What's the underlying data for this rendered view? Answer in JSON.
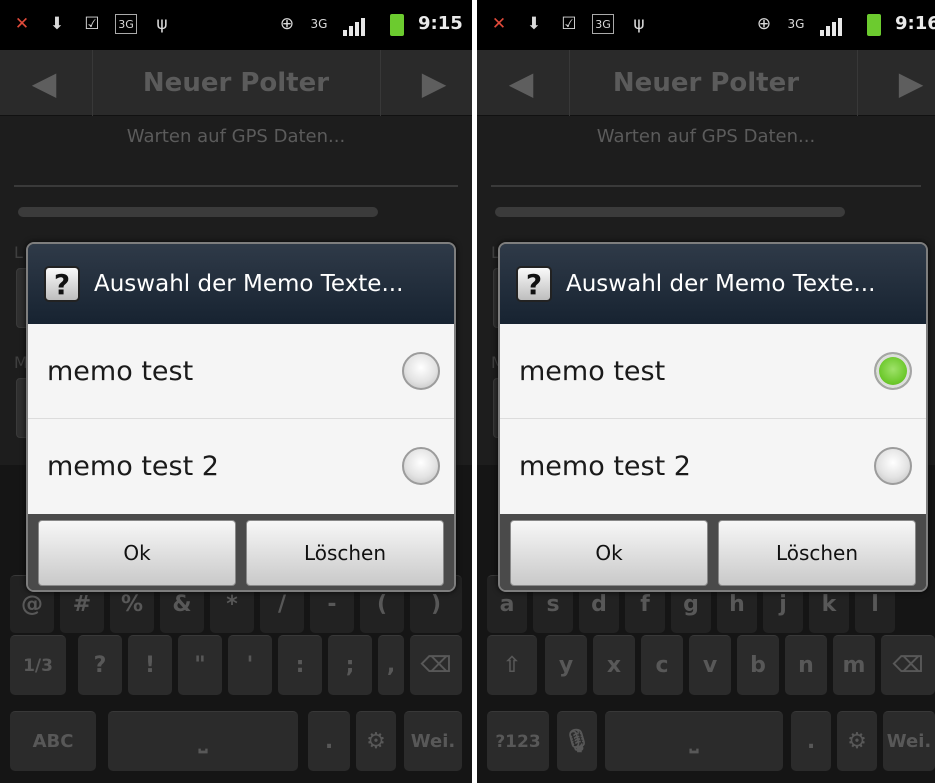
{
  "screens": [
    {
      "status": {
        "time": "9:15"
      },
      "title": "Neuer Polter",
      "gps_status": "Warten auf GPS Daten...",
      "dialog": {
        "title": "Auswahl der Memo Texte...",
        "items": [
          {
            "label": "memo test",
            "checked": false
          },
          {
            "label": "memo test 2",
            "checked": false
          }
        ],
        "ok_label": "Ok",
        "delete_label": "Löschen"
      },
      "keyboard": {
        "row2": [
          "1/3",
          "?",
          "!",
          "\"",
          "'",
          ":",
          ";",
          ","
        ],
        "row3": {
          "left": "ABC",
          "right": "Wei."
        }
      }
    },
    {
      "status": {
        "time": "9:16"
      },
      "title": "Neuer Polter",
      "gps_status": "Warten auf GPS Daten...",
      "dialog": {
        "title": "Auswahl der Memo Texte...",
        "items": [
          {
            "label": "memo test",
            "checked": true
          },
          {
            "label": "memo test 2",
            "checked": false
          }
        ],
        "ok_label": "Ok",
        "delete_label": "Löschen"
      },
      "keyboard": {
        "row2": [
          "y",
          "x",
          "c",
          "v",
          "b",
          "n",
          "m"
        ],
        "row3": {
          "left": "?123",
          "right": "Wei."
        }
      }
    }
  ],
  "colors": {
    "radio_checked": "#6cc82b",
    "dialog_header": "#1f2b3a"
  }
}
